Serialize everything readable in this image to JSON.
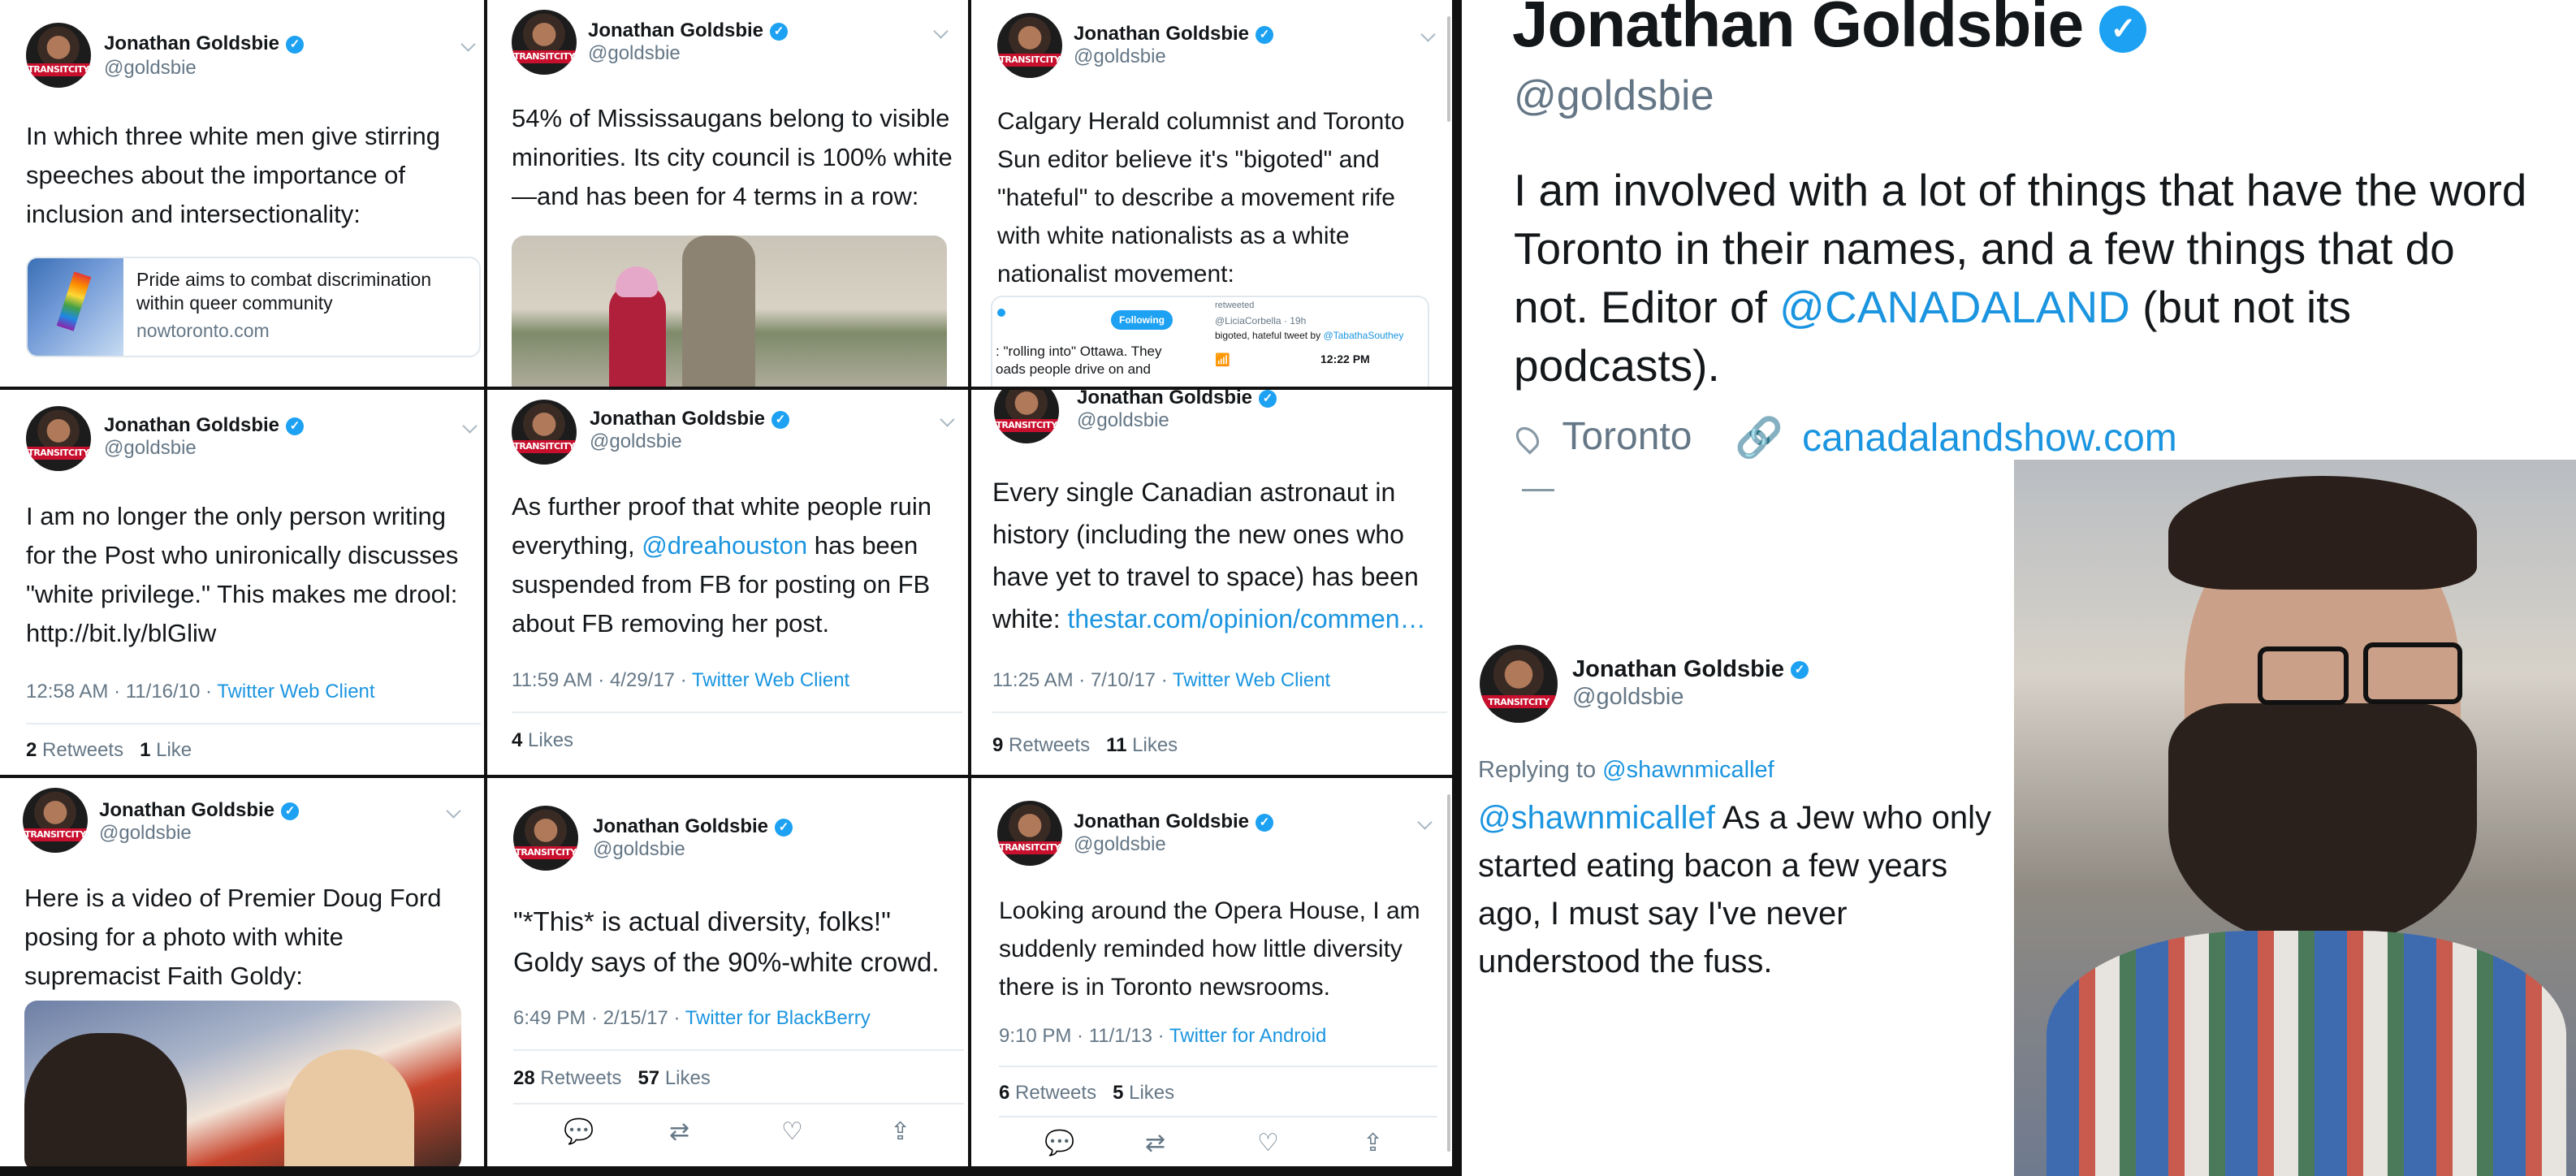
{
  "user": {
    "name": "Jonathan Goldsbie",
    "handle": "@goldsbie",
    "avatar_text": "TRANSITCITY",
    "verified_icon": "verified-badge-icon"
  },
  "tweets": [
    {
      "text": "In which three white men give stirring speeches about the importance of inclusion and intersectionality:",
      "card": {
        "title": "Pride aims to combat discrimination within queer community",
        "domain": "nowtoronto.com"
      }
    },
    {
      "text": "54% of Mississaugans belong to visible minorities. Its city council is 100% white—and has been for 4 terms in a row:"
    },
    {
      "text": "Calgary Herald columnist and Toronto Sun editor believe it's \"bigoted\" and \"hateful\" to describe a movement rife with white nationalists as a white nationalist movement:",
      "embed": {
        "following": "Following",
        "retweeted": "retweeted",
        "author": "@LiciaCorbella · 19h",
        "snippet": "bigoted, hateful tweet by",
        "mention": "@TabathaSouthey",
        "time": "12:22 PM",
        "left_text": ": \"rolling into\" Ottawa. They\noads people drive on and"
      }
    },
    {
      "text": "I am no longer the only person writing for the Post who unironically discusses \"white privilege.\" This makes me drool: http://bit.ly/blGliw",
      "time": "12:58 AM · 11/16/10 · ",
      "source": "Twitter Web Client",
      "retweets": "2",
      "retweets_label": "Retweets",
      "likes": "1",
      "likes_label": "Like"
    },
    {
      "text_before": "As further proof that white people ruin everything, ",
      "mention": "@dreahouston",
      "text_after": " has been suspended from FB for posting on FB about FB removing her post.",
      "time": "11:59 AM · 4/29/17 · ",
      "source": "Twitter Web Client",
      "likes": "4",
      "likes_label": "Likes"
    },
    {
      "text_before": "Every single Canadian astronaut in history (including the new ones who have yet to travel to space) has been white: ",
      "link": "thestar.com/opinion/commen…",
      "time": "11:25 AM · 7/10/17 · ",
      "source": "Twitter Web Client",
      "retweets": "9",
      "retweets_label": "Retweets",
      "likes": "11",
      "likes_label": "Likes"
    },
    {
      "text": "Here is a video of Premier Doug Ford posing for a photo with white supremacist Faith Goldy:"
    },
    {
      "text": "\"*This* is actual diversity, folks!\" Goldy says of the 90%-white crowd.",
      "time": "6:49 PM · 2/15/17 · ",
      "source": "Twitter for BlackBerry",
      "retweets": "28",
      "retweets_label": "Retweets",
      "likes": "57",
      "likes_label": "Likes"
    },
    {
      "text": "Looking around the Opera House, I am suddenly reminded how little diversity there is in Toronto newsrooms.",
      "time": "9:10 PM · 11/1/13 · ",
      "source": "Twitter for Android",
      "retweets": "6",
      "retweets_label": "Retweets",
      "likes": "5",
      "likes_label": "Likes"
    }
  ],
  "actions": {
    "reply": "reply-icon",
    "retweet": "retweet-icon",
    "like": "like-icon",
    "share": "share-icon"
  },
  "profile": {
    "name": "Jonathan Goldsbie",
    "handle": "@goldsbie",
    "bio_before": "I am involved with a lot of things that have the word Toronto in their names, and a few things that do not. Editor of ",
    "bio_mention": "@CANADALAND",
    "bio_after": " (but not its podcasts).",
    "location": "Toronto",
    "website": "canadalandshow.com"
  },
  "reply_tweet": {
    "replying_label": "Replying to ",
    "replying_to": "@shawnmicallef",
    "mention": "@shawnmicallef",
    "text": " As a Jew who only started eating bacon a few years ago, I must say I've never understood the fuss."
  },
  "colors": {
    "link": "#1b95e0",
    "verified": "#1da1f2",
    "muted": "#657786",
    "text": "#14171a"
  }
}
